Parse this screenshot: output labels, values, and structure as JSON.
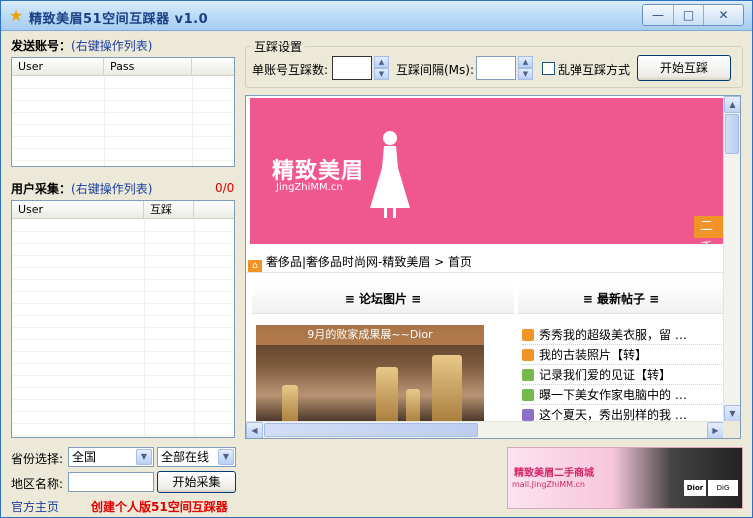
{
  "window": {
    "title": "精致美眉51空间互踩器  v1.0",
    "controls": {
      "minimize": "—",
      "maximize": "□",
      "close": "✕"
    }
  },
  "send_accounts": {
    "label": "发送账号：",
    "hint": "(右键操作列表)",
    "columns": [
      "User",
      "Pass"
    ]
  },
  "user_collect": {
    "label": "用户采集：",
    "hint": "(右键操作列表)",
    "count": "0/0",
    "columns": [
      "User",
      "互踩"
    ]
  },
  "filters": {
    "province_label": "省份选择:",
    "province_value": "全国",
    "online_value": "全部在线",
    "region_label": "地区名称:",
    "region_value": "",
    "collect_button": "开始采集"
  },
  "footer": {
    "homepage_link": "官方主页",
    "promo_text": "创建个人版51空间互踩器"
  },
  "settings": {
    "group_title": "互踩设置",
    "per_account_label": "单账号互踩数:",
    "per_account_value": "",
    "interval_label": "互踩间隔(Ms):",
    "interval_value": "",
    "random_label": "乱弹互踩方式",
    "random_checked": false,
    "start_button": "开始互踩"
  },
  "browser": {
    "banner_logo": "精致美眉",
    "banner_sub": "JingZhiMM.cn",
    "banner_tab": "二手",
    "breadcrumb": "奢侈品|奢侈品时尚网-精致美眉 > 首页",
    "panel_photos": "≡ 论坛图片 ≡",
    "panel_posts": "≡ 最新帖子 ≡",
    "photo_caption": "9月的败家成果展~~Dior",
    "posts": [
      {
        "text": "秀秀我的超级美衣服，留 …",
        "color": "#f29327"
      },
      {
        "text": "我的古装照片【转】",
        "color": "#f29327"
      },
      {
        "text": "记录我们爱的见证【转】",
        "color": "#74b94a"
      },
      {
        "text": "曝一下美女作家电脑中的 …",
        "color": "#74b94a"
      },
      {
        "text": "这个夏天，秀出别样的我 …",
        "color": "#8c6fc9"
      }
    ]
  },
  "ad": {
    "title": "精致美眉二手商城",
    "url": "mall.JingZhiMM.cn",
    "logo1": "Dior",
    "logo2": "DiG"
  }
}
